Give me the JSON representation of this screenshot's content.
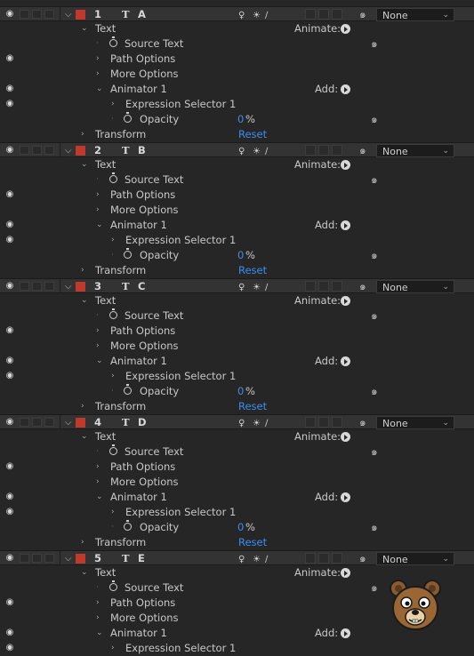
{
  "layers": [
    {
      "number": "1",
      "type_icon": "T",
      "name": "A",
      "parent": "None"
    },
    {
      "number": "2",
      "type_icon": "T",
      "name": "B",
      "parent": "None"
    },
    {
      "number": "3",
      "type_icon": "T",
      "name": "C",
      "parent": "None"
    },
    {
      "number": "4",
      "type_icon": "T",
      "name": "D",
      "parent": "None"
    },
    {
      "number": "5",
      "type_icon": "T",
      "name": "E",
      "parent": "None"
    }
  ],
  "labels": {
    "text_group": "Text",
    "animate": "Animate:",
    "source_text": "Source Text",
    "path_options": "Path Options",
    "more_options": "More Options",
    "animator": "Animator 1",
    "add": "Add:",
    "expression_selector": "Expression Selector 1",
    "opacity": "Opacity",
    "opacity_value": "0",
    "opacity_unit": "%",
    "transform": "Transform",
    "reset": "Reset"
  },
  "colors": {
    "label_color": "#c0392b",
    "value_blue": "#3b8ef0",
    "panel_bg": "#262626",
    "layer_row_bg": "#333333"
  },
  "icons": {
    "visibility": "eye-icon",
    "twirl_open": "chevron-down-icon",
    "twirl_closed": "chevron-right-icon",
    "stopwatch": "stopwatch-icon",
    "expression_pick": "pick-whip-spiral-icon",
    "play_menu": "play-menu-icon",
    "mascot": "bear-face-icon"
  }
}
